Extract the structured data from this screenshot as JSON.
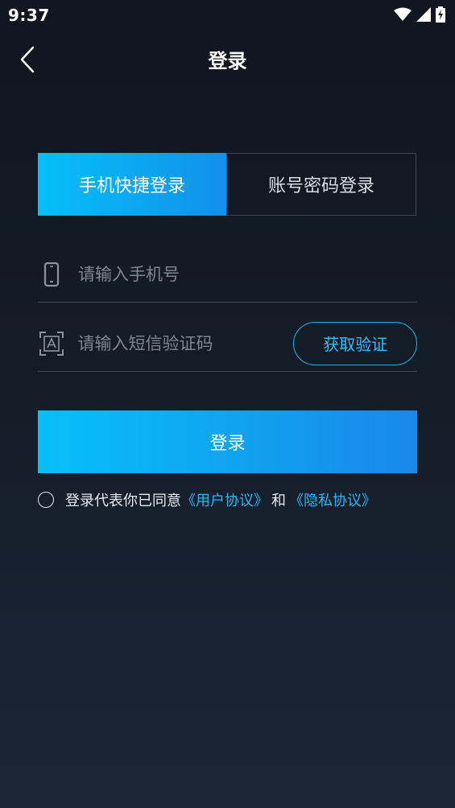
{
  "status_bar": {
    "time": "9:37"
  },
  "header": {
    "title": "登录"
  },
  "tabs": [
    {
      "label": "手机快捷登录",
      "active": true
    },
    {
      "label": "账号密码登录",
      "active": false
    }
  ],
  "form": {
    "phone": {
      "placeholder": "请输入手机号",
      "value": ""
    },
    "code": {
      "placeholder": "请输入短信验证码",
      "value": "",
      "get_code_label": "获取验证"
    }
  },
  "login_button": {
    "label": "登录"
  },
  "agreement": {
    "checked": false,
    "prefix": "登录代表你已同意",
    "user_agreement": "《用户协议》",
    "and": "和",
    "privacy_policy": "《隐私协议》"
  },
  "colors": {
    "accent": "#05bff8",
    "accent_end": "#1390ea",
    "link": "#23b7f5",
    "background_top": "#10161f",
    "background_bottom": "#1b2636"
  },
  "icons": {
    "status": [
      "wifi-icon",
      "cellular-signal-icon",
      "battery-charging-icon"
    ],
    "back": "chevron-left-icon",
    "phone_field": "mobile-phone-icon",
    "code_field": "verification-code-icon"
  }
}
